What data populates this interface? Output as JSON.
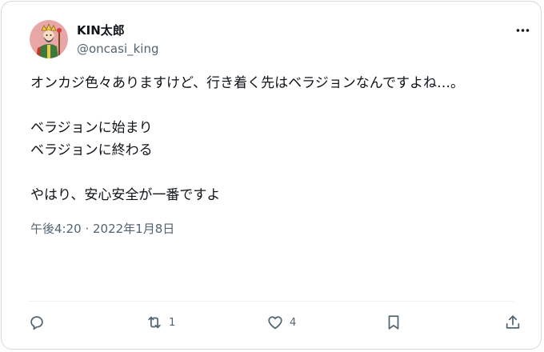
{
  "user": {
    "display_name": "KIN太郎",
    "handle": "@oncasi_king",
    "avatar_icon": "avatar-illustration-icon"
  },
  "tweet": {
    "lines": [
      "オンカジ色々ありますけど、行き着く先はベラジョンなんですよね…。",
      "",
      "ベラジョンに始まり",
      "ベラジョンに終わる",
      "",
      "やはり、安心安全が一番ですよ"
    ],
    "timestamp": "午後4:20 · 2022年1月8日"
  },
  "actions": {
    "reply_icon": "reply-icon",
    "retweet_icon": "retweet-icon",
    "retweet_count": "1",
    "like_icon": "heart-icon",
    "like_count": "4",
    "bookmark_icon": "bookmark-icon",
    "share_icon": "share-icon"
  },
  "colors": {
    "text": "#0f1419",
    "secondary": "#536471",
    "border": "#cfd9de"
  }
}
